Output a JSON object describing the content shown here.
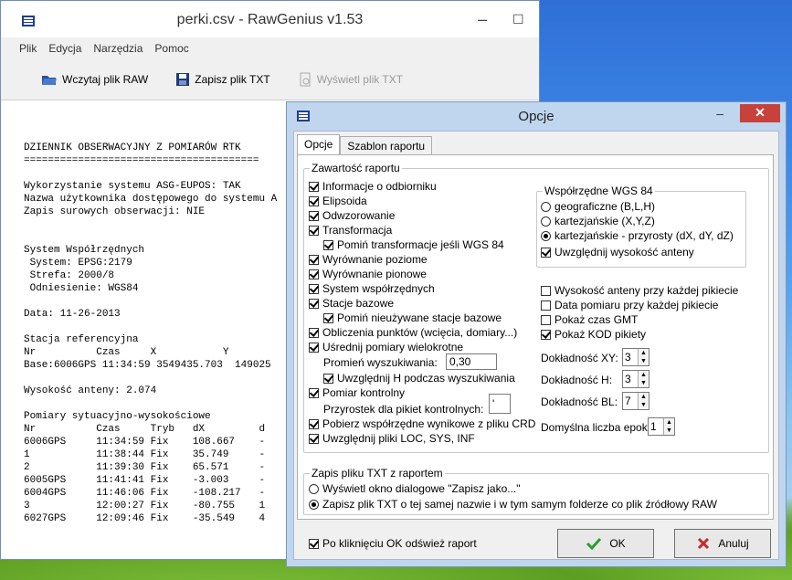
{
  "main_window": {
    "title": "perki.csv - RawGenius v1.53",
    "controls": {
      "minimize": "–",
      "maximize": "☐"
    },
    "menu": [
      "Plik",
      "Edycja",
      "Narzędzia",
      "Pomoc"
    ],
    "toolbar": {
      "load_raw": "Wczytaj plik RAW",
      "save_txt": "Zapisz plik TXT",
      "show_txt": "Wyświetl plik TXT"
    },
    "report_lines": [
      "DZIENNIK OBSERWACYJNY Z POMIARÓW RTK",
      "=======================================",
      "",
      "Wykorzystanie systemu ASG-EUPOS: TAK",
      "Nazwa użytkownika dostępowego do systemu A",
      "Zapis surowych obserwacji: NIE",
      "",
      "",
      "System Współrzędnych",
      " System: EPSG:2179",
      " Strefa: 2000/8",
      " Odniesienie: WGS84",
      "",
      "Data: 11-26-2013",
      "",
      "Stacja referencyjna",
      "Nr          Czas     X           Y",
      "Base:6006GPS 11:34:59 3549435.703  149025",
      "",
      "Wysokość anteny: 2.074",
      "",
      "Pomiary sytuacyjno-wysokościowe",
      "Nr          Czas     Tryb   dX         d",
      "6006GPS     11:34:59 Fix    108.667    -",
      "1           11:38:44 Fix    35.749     -",
      "2           11:39:30 Fix    65.571     -",
      "6005GPS     11:41:41 Fix    -3.003     -",
      "6004GPS     11:46:06 Fix    -108.217   -",
      "3           12:00:27 Fix    -80.755    1",
      "6027GPS     12:09:46 Fix    -35.549    4"
    ]
  },
  "dialog": {
    "title": "Opcje",
    "controls": {
      "minimize": "–",
      "close": "✕"
    },
    "tabs": [
      "Opcje",
      "Szablon raportu"
    ],
    "report_content": {
      "legend": "Zawartość raportu",
      "items": [
        {
          "label": "Informacje o odbiorniku",
          "checked": true
        },
        {
          "label": "Elipsoida",
          "checked": true
        },
        {
          "label": "Odwzorowanie",
          "checked": true
        },
        {
          "label": "Transformacja",
          "checked": true
        },
        {
          "label": "Pomiń transformacje jeśli WGS 84",
          "checked": true
        },
        {
          "label": "Wyrównanie poziome",
          "checked": true
        },
        {
          "label": "Wyrównanie pionowe",
          "checked": true
        },
        {
          "label": "System współrzędnych",
          "checked": true
        },
        {
          "label": "Stacje bazowe",
          "checked": true
        },
        {
          "label": "Pomiń nieużywane stacje bazowe",
          "checked": true
        },
        {
          "label": "Obliczenia punktów (wcięcia, domiary...)",
          "checked": true
        },
        {
          "label": "Uśrednij pomiary wielokrotne",
          "checked": true
        },
        {
          "label": "Uwzględnij H podczas wyszukiwania",
          "checked": true
        },
        {
          "label": "Pomiar kontrolny",
          "checked": true
        },
        {
          "label": "Pobierz współrzędne wynikowe z pliku CRD",
          "checked": true
        },
        {
          "label": "Uwzględnij pliki LOC, SYS, INF",
          "checked": true
        }
      ],
      "search_radius_label": "Promień wyszukiwania:",
      "search_radius_value": "0,30",
      "control_increment_label": "Przyrostek dla pikiet kontrolnych:",
      "control_increment_value": "'",
      "wgs84": {
        "legend": "Współrzędne WGS 84",
        "options": [
          "geograficzne (B,L,H)",
          "kartezjańskie (X,Y,Z)",
          "kartezjańskie - przyrosty (dX, dY, dZ)"
        ],
        "selected_index": 2,
        "antenna_label": "Uwzględnij wysokość anteny",
        "antenna_checked": true
      },
      "extra": [
        {
          "label": "Wysokość anteny przy każdej pikiecie",
          "checked": false
        },
        {
          "label": "Data pomiaru przy każdej pikiecie",
          "checked": false
        },
        {
          "label": "Pokaż czas GMT",
          "checked": false
        },
        {
          "label": "Pokaż KOD pikiety",
          "checked": true
        }
      ],
      "precision": [
        {
          "label": "Dokładność XY:",
          "value": "3"
        },
        {
          "label": "Dokładność H:",
          "value": "3"
        },
        {
          "label": "Dokładność BL:",
          "value": "7"
        },
        {
          "label": "Domyślna liczba epok",
          "value": "1"
        }
      ]
    },
    "txt_save": {
      "legend": "Zapis pliku TXT z raportem",
      "options": [
        "Wyświetl okno dialogowe \"Zapisz jako...\"",
        "Zapisz plik TXT o tej samej nazwie i w tym samym folderze co plik źródłowy RAW"
      ],
      "selected_index": 1
    },
    "refresh_label": "Po kliknięciu OK odśwież raport",
    "refresh_checked": true,
    "ok_label": "OK",
    "cancel_label": "Anuluj"
  }
}
